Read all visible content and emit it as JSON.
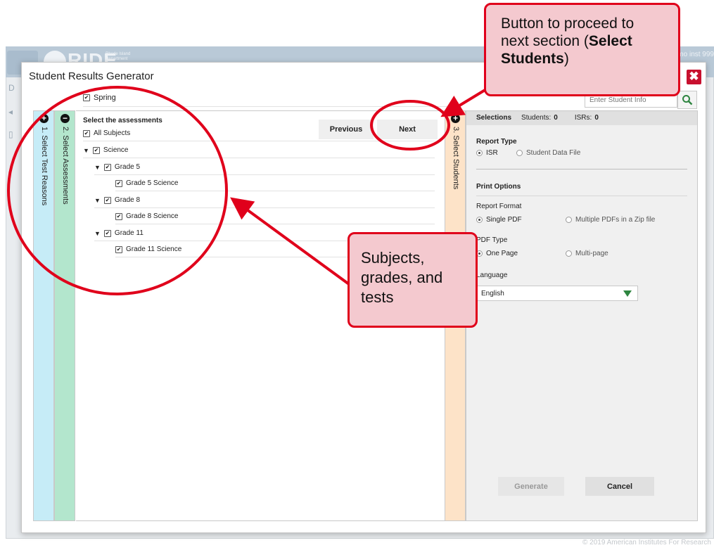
{
  "background_app": {
    "logo_text": "RIDE",
    "logo_subtext": "Rhode Island Department",
    "user_text": "mo inst 999",
    "footer": "© 2019 American Institutes For Research"
  },
  "modal": {
    "title": "Student Results Generator",
    "close_label": "✖",
    "search_placeholder": "Enter Student Info",
    "term_option": "Spring"
  },
  "tabs": [
    {
      "label": "1. Select Test Reasons",
      "icon": "plus-icon",
      "state": "collapsed"
    },
    {
      "label": "2. Select Assessments",
      "icon": "minus-icon",
      "state": "expanded"
    },
    {
      "label": "3. Select Students",
      "icon": "plus-icon",
      "state": "collapsed"
    }
  ],
  "assessments": {
    "heading": "Select the assessments",
    "all_subjects": "All Subjects",
    "subject": "Science",
    "grades": [
      {
        "label": "Grade 5",
        "test": "Grade 5 Science"
      },
      {
        "label": "Grade 8",
        "test": "Grade 8 Science"
      },
      {
        "label": "Grade 11",
        "test": "Grade 11 Science"
      }
    ],
    "previous_label": "Previous",
    "next_label": "Next"
  },
  "selections": {
    "title": "Selections",
    "students_label": "Students:",
    "students_count": "0",
    "isrs_label": "ISRs:",
    "isrs_count": "0",
    "report_type_title": "Report Type",
    "report_type_options": [
      "ISR",
      "Student Data File"
    ],
    "print_options_title": "Print Options",
    "report_format_label": "Report Format",
    "report_format_options": [
      "Single PDF",
      "Multiple PDFs in a Zip file"
    ],
    "pdf_type_label": "PDF Type",
    "pdf_type_options": [
      "One Page",
      "Multi-page"
    ],
    "language_label": "Language",
    "language_value": "English",
    "generate_label": "Generate",
    "cancel_label": "Cancel"
  },
  "annotations": {
    "top_callout_plain": "Button to proceed to next section (",
    "top_callout_bold": "Select Students",
    "top_callout_end": ")",
    "mid_callout": "Subjects, grades, and tests"
  },
  "colors": {
    "annotation_red": "#e0001b",
    "callout_fill": "#f4c9cf",
    "tab1": "#c6ecf7",
    "tab2": "#b3e6cd",
    "tab3": "#fde3c8",
    "close_red": "#c8102e",
    "select_arrow_green": "#2e8540"
  }
}
